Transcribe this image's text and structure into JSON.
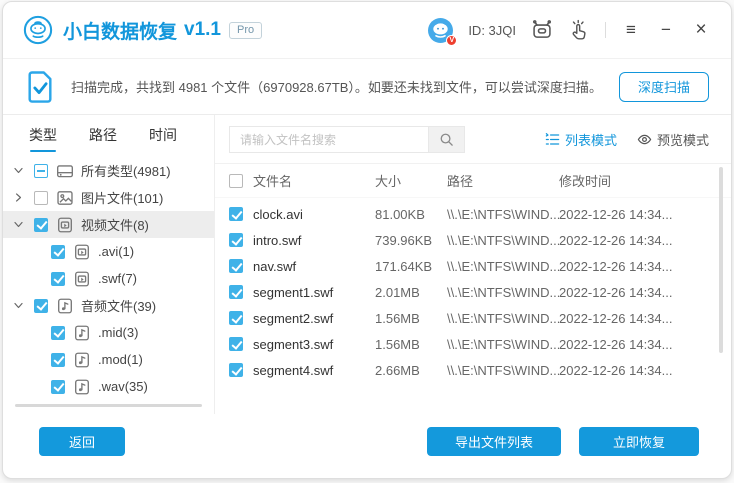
{
  "colors": {
    "accent": "#1296db",
    "checkbox_blue": "#3fb2e8",
    "button_blue": "#1499dc"
  },
  "titlebar": {
    "app_name": "小白数据恢复",
    "version": "v1.1",
    "badge": "Pro",
    "user_id": "ID: 3JQI",
    "avatar_badge": "V",
    "menu_glyph": "≡",
    "minimize_glyph": "−",
    "close_glyph": "×"
  },
  "notice": {
    "message": "扫描完成，共找到 4981 个文件（6970928.67TB）。如要还未找到文件，可以尝试深度扫描。",
    "deep_scan": "深度扫描"
  },
  "sidebar": {
    "tabs": [
      {
        "label": "类型",
        "active": true
      },
      {
        "label": "路径",
        "active": false
      },
      {
        "label": "时间",
        "active": false
      }
    ],
    "tree": [
      {
        "label": "所有类型(4981)",
        "level": 0,
        "expander": "open",
        "checkbox": "indeterminate",
        "icon": "drive-icon",
        "selected": false
      },
      {
        "label": "图片文件(101)",
        "level": 0,
        "expander": "closed",
        "checkbox": "unchecked",
        "icon": "image-file-icon",
        "selected": false
      },
      {
        "label": "视频文件(8)",
        "level": 0,
        "expander": "open",
        "checkbox": "checked",
        "icon": "video-file-icon",
        "selected": true
      },
      {
        "label": ".avi(1)",
        "level": 1,
        "expander": "none",
        "checkbox": "checked",
        "icon": "video-file-icon",
        "selected": false
      },
      {
        "label": ".swf(7)",
        "level": 1,
        "expander": "none",
        "checkbox": "checked",
        "icon": "video-file-icon",
        "selected": false
      },
      {
        "label": "音频文件(39)",
        "level": 0,
        "expander": "open",
        "checkbox": "checked",
        "icon": "audio-file-icon",
        "selected": false
      },
      {
        "label": ".mid(3)",
        "level": 1,
        "expander": "none",
        "checkbox": "checked",
        "icon": "audio-file-icon",
        "selected": false
      },
      {
        "label": ".mod(1)",
        "level": 1,
        "expander": "none",
        "checkbox": "checked",
        "icon": "audio-file-icon",
        "selected": false
      },
      {
        "label": ".wav(35)",
        "level": 1,
        "expander": "none",
        "checkbox": "checked",
        "icon": "audio-file-icon",
        "selected": false
      }
    ]
  },
  "toolbar": {
    "search_placeholder": "请输入文件名搜索",
    "list_mode": "列表模式",
    "preview_mode": "预览模式"
  },
  "table": {
    "headers": [
      "文件名",
      "大小",
      "路径",
      "修改时间"
    ],
    "rows": [
      {
        "checked": true,
        "name": "clock.avi",
        "size": "81.00KB",
        "path": "\\\\.\\E:\\NTFS\\WIND...",
        "modified": "2022-12-26 14:34..."
      },
      {
        "checked": true,
        "name": "intro.swf",
        "size": "739.96KB",
        "path": "\\\\.\\E:\\NTFS\\WIND...",
        "modified": "2022-12-26 14:34..."
      },
      {
        "checked": true,
        "name": "nav.swf",
        "size": "171.64KB",
        "path": "\\\\.\\E:\\NTFS\\WIND...",
        "modified": "2022-12-26 14:34..."
      },
      {
        "checked": true,
        "name": "segment1.swf",
        "size": "2.01MB",
        "path": "\\\\.\\E:\\NTFS\\WIND...",
        "modified": "2022-12-26 14:34..."
      },
      {
        "checked": true,
        "name": "segment2.swf",
        "size": "1.56MB",
        "path": "\\\\.\\E:\\NTFS\\WIND...",
        "modified": "2022-12-26 14:34..."
      },
      {
        "checked": true,
        "name": "segment3.swf",
        "size": "1.56MB",
        "path": "\\\\.\\E:\\NTFS\\WIND...",
        "modified": "2022-12-26 14:34..."
      },
      {
        "checked": true,
        "name": "segment4.swf",
        "size": "2.66MB",
        "path": "\\\\.\\E:\\NTFS\\WIND...",
        "modified": "2022-12-26 14:34..."
      }
    ]
  },
  "footer": {
    "back": "返回",
    "export_list": "导出文件列表",
    "recover_now": "立即恢复"
  }
}
